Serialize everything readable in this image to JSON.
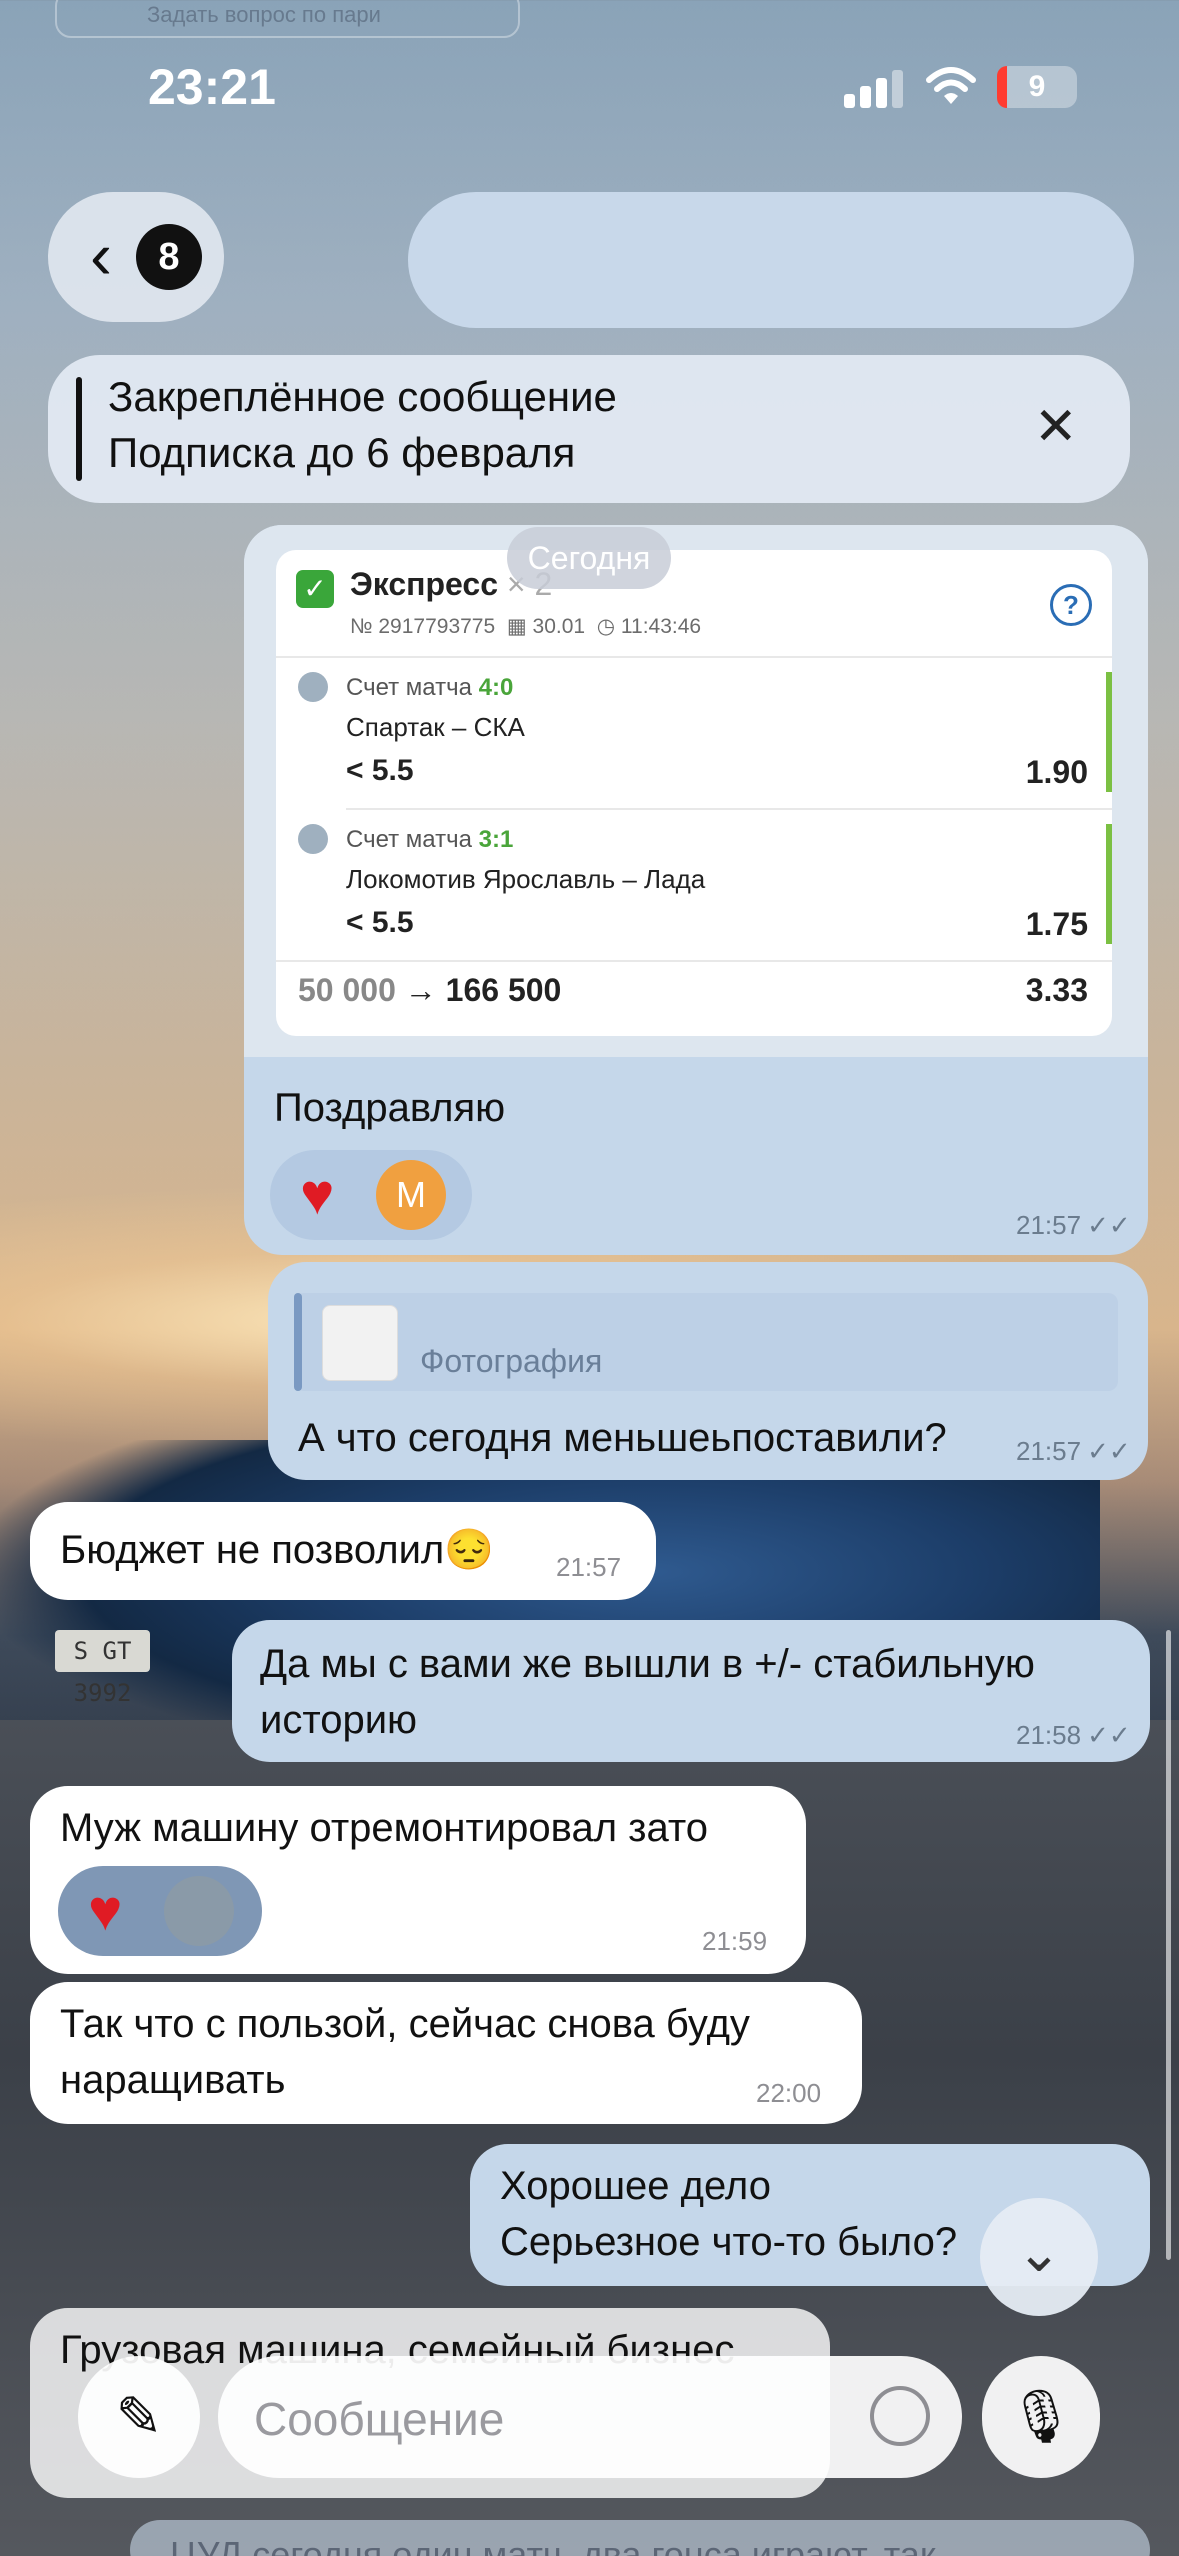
{
  "status_bar": {
    "time": "23:21",
    "battery": "9"
  },
  "ghost_top": {
    "text": "Задать вопрос по пари"
  },
  "nav": {
    "back_count": "8"
  },
  "pinned": {
    "title": "Закреплённое сообщение",
    "text": "Подписка до 6 февраля"
  },
  "date_chip": "Сегодня",
  "bet_slip": {
    "title": "Экспресс",
    "title_suffix": "× 2",
    "number": "№ 2917793775",
    "date": "30.01",
    "time": "11:43:46",
    "legs": [
      {
        "score_label": "Счет матча",
        "score": "4:0",
        "match": "Спартак – СКА",
        "total": "< 5.5",
        "odd": "1.90"
      },
      {
        "score_label": "Счет матча",
        "score": "3:1",
        "match": "Локомотив Ярославль – Лада",
        "total": "< 5.5",
        "odd": "1.75"
      }
    ],
    "stake": "50 000",
    "payout": "166 500",
    "total_odd": "3.33"
  },
  "messages": {
    "m1": {
      "text": "Поздравляю",
      "time": "21:57",
      "avatar_letter": "М"
    },
    "m2": {
      "reply_label": "Фотография",
      "text": "А что сегодня меньшеьпоставили?",
      "time": "21:57"
    },
    "m3": {
      "text": "Бюджет не позволил😔",
      "time": "21:57"
    },
    "m4": {
      "text": "Да мы с вами же вышли в +/- стабильную историю",
      "time": "21:58"
    },
    "m5": {
      "text": "Муж машину отремонтировал зато",
      "time": "21:59"
    },
    "m6": {
      "text": "Так что с пользой, сейчас снова буду наращивать",
      "time": "22:00"
    },
    "m7": {
      "line1": "Хорошее дело",
      "line2": "Серьезное что-то было?"
    },
    "m8": {
      "text": "Грузовая машина, семейный бизнес"
    }
  },
  "input": {
    "placeholder": "Сообщение"
  },
  "bottom_ghost": {
    "text": "ЦУД сегодня один матч, два гонса играют, так"
  },
  "plate": "S GT 3992",
  "colors": {
    "outgoing": "#c5d7ea",
    "incoming": "#ffffff",
    "accent": "#2a6db5",
    "win": "#4aa53a"
  }
}
